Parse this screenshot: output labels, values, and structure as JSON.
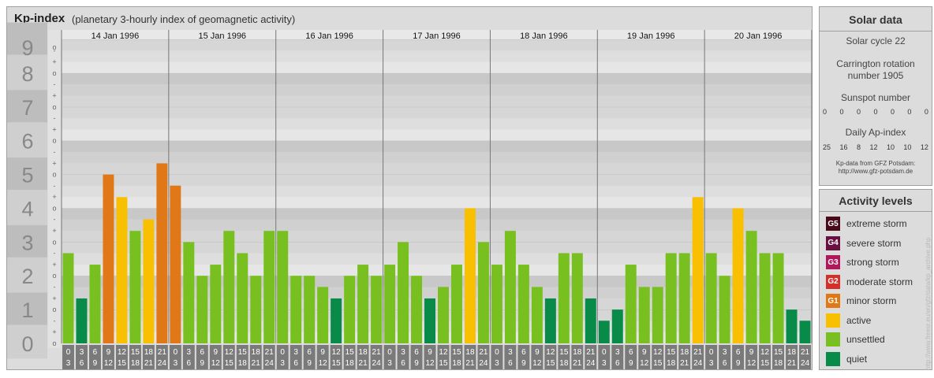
{
  "header": {
    "title": "Kp-index",
    "subtitle": "(planetary 3-hourly index of geomagnetic activity)"
  },
  "chart_data": {
    "type": "bar",
    "title": "Kp-index",
    "subtitle": "(planetary 3-hourly index of geomagnetic activity)",
    "ylim": [
      0,
      9
    ],
    "y_ticks": [
      "0",
      "1",
      "2",
      "3",
      "4",
      "5",
      "6",
      "7",
      "8",
      "9"
    ],
    "minor_ticks": [
      "o",
      "+",
      "-"
    ],
    "days": [
      "14 Jan 1996",
      "15 Jan 1996",
      "16 Jan 1996",
      "17 Jan 1996",
      "18 Jan 1996",
      "19 Jan 1996",
      "20 Jan 1996"
    ],
    "hour_labels": [
      [
        "0",
        "3"
      ],
      [
        "3",
        "6"
      ],
      [
        "6",
        "9"
      ],
      [
        "9",
        "12"
      ],
      [
        "12",
        "15"
      ],
      [
        "15",
        "18"
      ],
      [
        "18",
        "21"
      ],
      [
        "21",
        "24"
      ]
    ],
    "values": [
      [
        2.67,
        1.33,
        2.33,
        5.0,
        4.33,
        3.33,
        3.67,
        5.33
      ],
      [
        4.67,
        3.0,
        2.0,
        2.33,
        3.33,
        2.67,
        2.0,
        3.33
      ],
      [
        3.33,
        2.0,
        2.0,
        1.67,
        1.33,
        2.0,
        2.33,
        2.0
      ],
      [
        2.33,
        3.0,
        2.0,
        1.33,
        1.67,
        2.33,
        4.0,
        3.0
      ],
      [
        2.33,
        3.33,
        2.33,
        1.67,
        1.33,
        2.67,
        2.67,
        1.33
      ],
      [
        0.67,
        1.0,
        2.33,
        1.67,
        1.67,
        2.67,
        2.67,
        4.33
      ],
      [
        2.67,
        2.0,
        4.0,
        3.33,
        2.67,
        2.67,
        1.0,
        0.67
      ]
    ],
    "grid": true
  },
  "solar": {
    "title": "Solar data",
    "cycle": "Solar cycle 22",
    "carrington_line1": "Carrington rotation",
    "carrington_line2": "number 1905",
    "sunspot_title": "Sunspot number",
    "sunspot_values": [
      "0",
      "0",
      "0",
      "0",
      "0",
      "0",
      "0"
    ],
    "ap_title": "Daily Ap-index",
    "ap_values": [
      "25",
      "16",
      "8",
      "12",
      "10",
      "10",
      "12"
    ],
    "source_line1": "Kp-data from GFZ Potsdam:",
    "source_line2": "http://www.gfz-potsdam.de"
  },
  "activity": {
    "title": "Activity levels",
    "levels": [
      {
        "code": "G5",
        "label": "extreme storm",
        "color": "#4a0a1a"
      },
      {
        "code": "G4",
        "label": "severe storm",
        "color": "#6a1040"
      },
      {
        "code": "G3",
        "label": "strong storm",
        "color": "#b0185a"
      },
      {
        "code": "G2",
        "label": "moderate storm",
        "color": "#d4302a"
      },
      {
        "code": "G1",
        "label": "minor storm",
        "color": "#e07818"
      },
      {
        "code": "",
        "label": "active",
        "color": "#f8c000"
      },
      {
        "code": "",
        "label": "unsettled",
        "color": "#78c020"
      },
      {
        "code": "",
        "label": "quiet",
        "color": "#088a48"
      }
    ]
  },
  "copyright": "http://www.freesr.eu/en/gfz/data/kp_archive.php"
}
